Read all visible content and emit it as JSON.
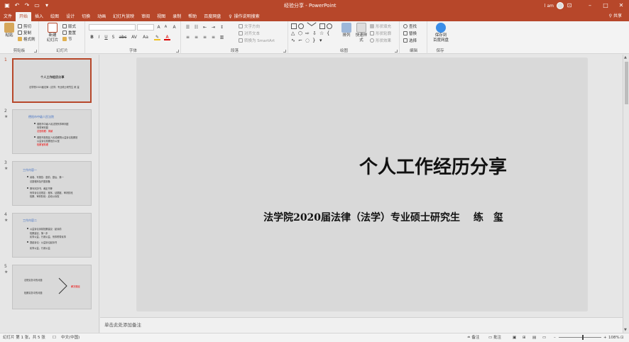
{
  "titlebar": {
    "doc_title": "经验分享 - PowerPoint",
    "user_name": "l am",
    "save_icon": "save-icon",
    "undo_icon": "undo-icon",
    "redo_icon": "redo-icon",
    "present_icon": "start-presentation-icon"
  },
  "tabs": [
    "文件",
    "开始",
    "插入",
    "绘图",
    "设计",
    "切换",
    "动画",
    "幻灯片放映",
    "审阅",
    "视图",
    "录制",
    "帮助",
    "百度网盘"
  ],
  "active_tab": "开始",
  "tell_me": "操作说明搜索",
  "share": "共享",
  "ribbon": {
    "clipboard": {
      "label": "剪贴板",
      "paste": "粘贴",
      "cut": "剪切",
      "copy": "复制",
      "format_painter": "格式刷"
    },
    "slides": {
      "label": "幻灯片",
      "new_slide": "新建",
      "new_slide_line2": "幻灯片",
      "layout": "版式",
      "reset": "重置",
      "section": "节"
    },
    "font": {
      "label": "字体",
      "bold": "B",
      "italic": "I",
      "underline": "U",
      "strike": "S",
      "abc": "abc",
      "spacing": "AV",
      "case": "Aa",
      "grow": "A",
      "shrink": "A",
      "clear": "A"
    },
    "paragraph": {
      "label": "段落",
      "text_direction": "文字方向",
      "align_text": "对齐文本",
      "smartart": "转换为 SmartArt"
    },
    "drawing": {
      "label": "绘图",
      "arrange": "排列",
      "quick_styles": "快速样式",
      "shape_fill": "形状填充",
      "shape_outline": "形状轮廓",
      "shape_effects": "形状效果"
    },
    "editing": {
      "label": "编辑",
      "find": "查找",
      "replace": "替换",
      "select": "选择"
    },
    "save": {
      "label": "保存",
      "save_to": "保存到",
      "baidu": "百度网盘"
    }
  },
  "thumbnails": [
    {
      "number": "1",
      "title": "个人工作经历分享",
      "subtitle": "法学院2020届法律（法学）专业硕士研究生    练 玺"
    },
    {
      "number": "2",
      "title": "德阳市中级人民法院",
      "lines": [
        {
          "text": "德阳市中级人民法院刑事审判庭",
          "red": false
        },
        {
          "text": "刑事审判庭",
          "red": false
        },
        {
          "text": "法官助理：周颖",
          "red": true
        },
        {
          "text": "德阳市旌阳区人民检察院公益诉讼检察官",
          "red": false
        },
        {
          "text": "公益诉讼检察官办公室",
          "red": false
        },
        {
          "text": "检察官助理",
          "red": true
        }
      ]
    },
    {
      "number": "3",
      "title": "工作内容一",
      "lines": [
        {
          "text": "阅卷、写报告：庭前、庭后、第一",
          "red": false
        },
        {
          "text": "法庭程序及开庭准备",
          "red": false
        },
        {
          "text": "撰写判决书、裁定书等",
          "red": false
        },
        {
          "text": "刑事诉讼法规定：程序、证据链、审判阶段",
          "red": false
        },
        {
          "text": "检察、审判阶段：启动公诉权",
          "red": false
        }
      ]
    },
    {
      "number": "4",
      "title": "工作内容二",
      "lines": [
        {
          "text": "公益诉讼诉前检察建议：起诉前",
          "red": false
        },
        {
          "text": "检察建议、第一步",
          "red": false
        },
        {
          "text": "民事公益、行政公益、刑事附带民事",
          "red": false
        },
        {
          "text": "提起诉讼：公益诉讼起诉书",
          "red": false
        },
        {
          "text": "民事公益、行政公益",
          "red": false
        }
      ]
    },
    {
      "number": "5",
      "lines": [
        {
          "text": "法院实务中的问题",
          "red": false
        },
        {
          "text": "检察实务中的问题",
          "red": false
        },
        {
          "text": "解决路径",
          "red": true
        }
      ]
    }
  ],
  "slide": {
    "title": "个人工作经历分享",
    "subtitle": "法学院2020届法律（法学）专业硕士研究生　 练　玺"
  },
  "notes_placeholder": "单击此处添加备注",
  "status": {
    "slide_info": "幻灯片 第 1 张，共 5 张",
    "language": "中文(中国)",
    "notes_btn": "备注",
    "comments_btn": "批注",
    "zoom": "108%"
  }
}
